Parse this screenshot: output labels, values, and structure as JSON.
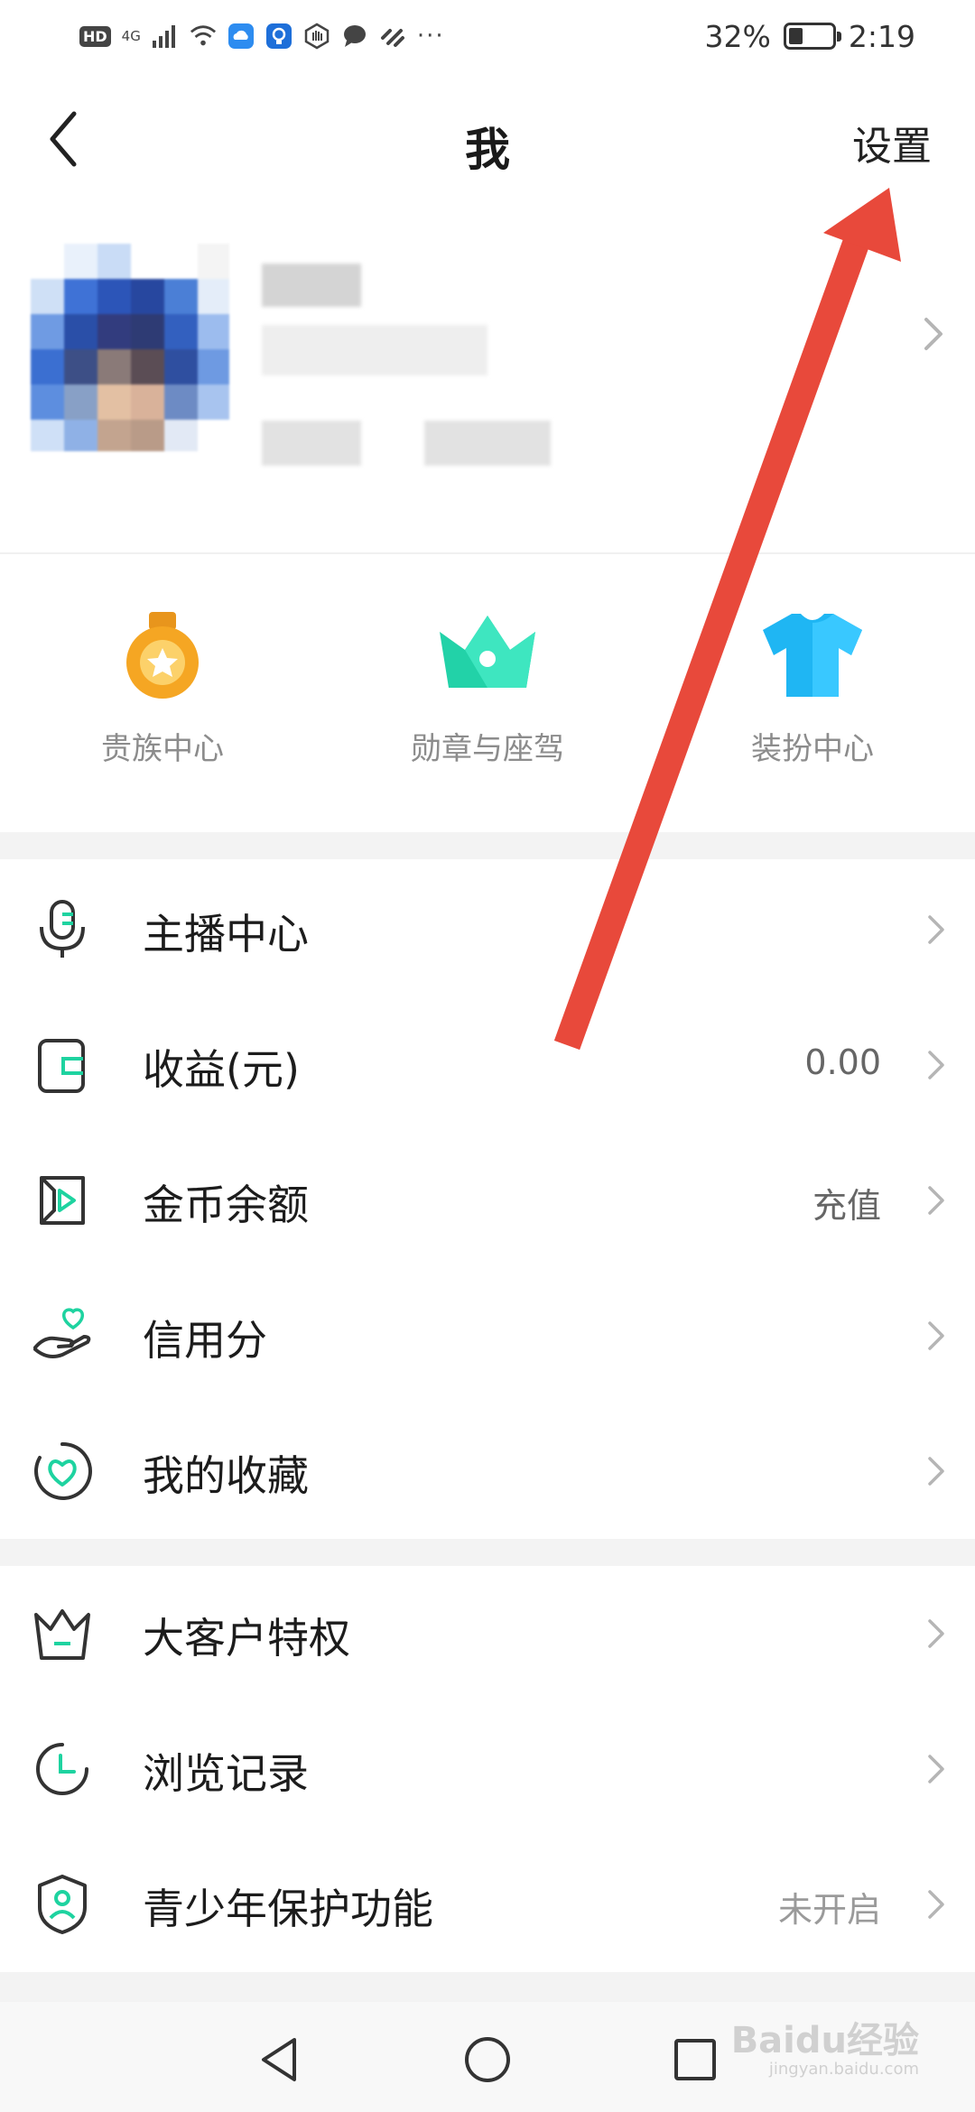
{
  "status_bar": {
    "hd": "HD",
    "network": "4G",
    "more": "···",
    "battery_percent": "32%",
    "battery_level": 0.32,
    "time": "2:19"
  },
  "nav": {
    "title": "我",
    "settings_label": "设置",
    "back_icon": "chevron-left-icon"
  },
  "profile": {
    "avatar_icon": "pixelated-avatar",
    "chevron_icon": "chevron-right-icon"
  },
  "quick_entries": [
    {
      "label": "贵族中心",
      "icon": "medal-star-icon",
      "color": "#f5a623"
    },
    {
      "label": "勋章与座驾",
      "icon": "crown-icon",
      "color": "#22d2a8"
    },
    {
      "label": "装扮中心",
      "icon": "tshirt-icon",
      "color": "#1fb6f3"
    }
  ],
  "menu_group_1": [
    {
      "label": "主播中心",
      "value": "",
      "icon": "microphone-icon"
    },
    {
      "label": "收益(元)",
      "value": "0.00",
      "icon": "wallet-icon"
    },
    {
      "label": "金币余额",
      "value": "充值",
      "icon": "coin-play-icon"
    },
    {
      "label": "信用分",
      "value": "",
      "icon": "hand-heart-icon"
    },
    {
      "label": "我的收藏",
      "value": "",
      "icon": "heart-circle-icon"
    }
  ],
  "menu_group_2": [
    {
      "label": "大客户特权",
      "value": "",
      "icon": "crown-outline-icon"
    },
    {
      "label": "浏览记录",
      "value": "",
      "icon": "clock-icon"
    },
    {
      "label": "青少年保护功能",
      "value": "未开启",
      "icon": "shield-user-icon"
    }
  ],
  "system_nav": {
    "back_icon": "triangle-back-icon",
    "home_icon": "circle-home-icon",
    "recent_icon": "square-recent-icon"
  },
  "watermark": {
    "text": "Baidu经验",
    "sub": "jingyan.baidu.com"
  },
  "colors": {
    "accent": "#1ed3a0",
    "annotation_arrow": "#e8493b"
  }
}
